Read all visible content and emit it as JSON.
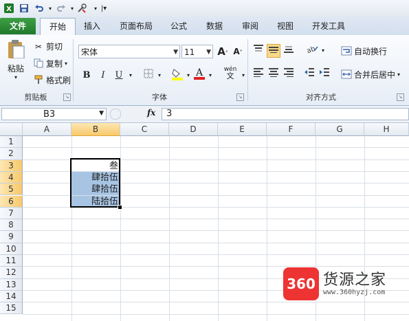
{
  "qat": {
    "app_icon": "excel-icon",
    "save_icon": "save-icon",
    "undo_icon": "undo-icon",
    "redo_icon": "redo-icon",
    "tools_icon": "tools-icon",
    "customize_icon": "customize-icon"
  },
  "tabs": [
    "文件",
    "开始",
    "插入",
    "页面布局",
    "公式",
    "数据",
    "审阅",
    "视图",
    "开发工具"
  ],
  "active_tab": "开始",
  "ribbon": {
    "clipboard": {
      "paste": "粘贴",
      "cut": "剪切",
      "copy": "复制",
      "format_painter": "格式刷",
      "label": "剪贴板"
    },
    "font": {
      "name": "宋体",
      "size": "11",
      "grow": "A",
      "shrink": "A",
      "bold": "B",
      "italic": "I",
      "underline": "U",
      "phonetic": "wén",
      "label": "字体"
    },
    "alignment": {
      "wrap_text": "自动换行",
      "merge_center": "合并后居中",
      "label": "对齐方式"
    }
  },
  "formula_bar": {
    "name_box": "B3",
    "fx": "fx",
    "value": "3"
  },
  "columns": [
    "A",
    "B",
    "C",
    "D",
    "E",
    "F",
    "G",
    "H"
  ],
  "selected_column": "B",
  "rows": [
    "1",
    "2",
    "3",
    "4",
    "5",
    "6",
    "7",
    "8",
    "9",
    "10",
    "11",
    "12",
    "13",
    "14",
    "15"
  ],
  "selected_rows": [
    "3",
    "4",
    "5",
    "6"
  ],
  "cells": [
    {
      "ref": "B3",
      "value": "叁"
    },
    {
      "ref": "B4",
      "value": "肆拾伍"
    },
    {
      "ref": "B5",
      "value": "肆拾伍"
    },
    {
      "ref": "B6",
      "value": "陆拾伍"
    }
  ],
  "watermark": {
    "logo": "360",
    "title": "货源之家",
    "url": "www.360hyzj.com"
  },
  "colors": {
    "file_tab": "#1f7a2a",
    "selection_fill": "#a7c4e3",
    "header_selected": "#f7c96b",
    "logo_red": "#e33333"
  }
}
